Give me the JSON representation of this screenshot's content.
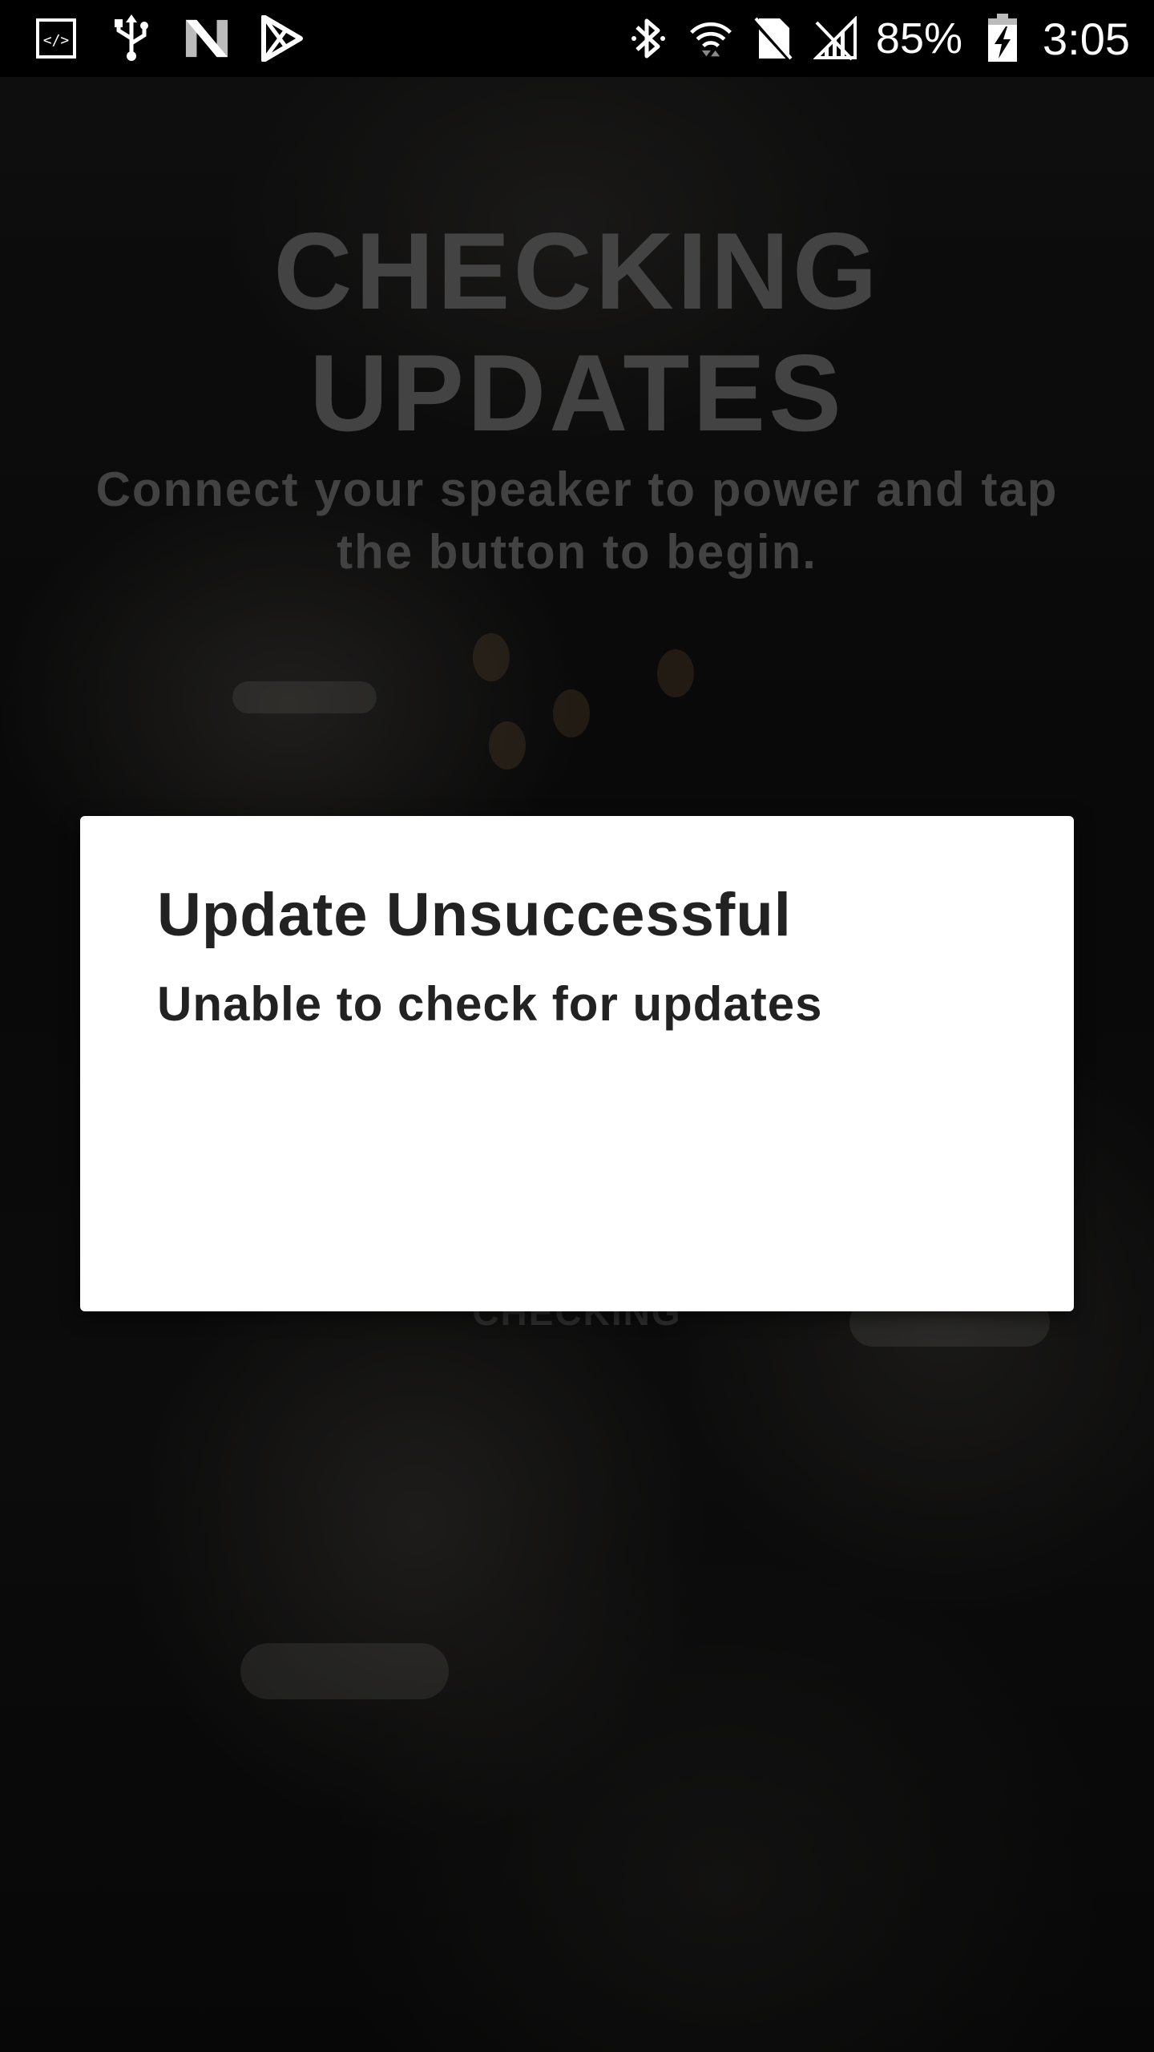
{
  "status_bar": {
    "left_icons": [
      "debug-icon",
      "usb-icon",
      "n-icon",
      "play-store-icon"
    ],
    "right_icons": [
      "bluetooth-icon",
      "wifi-icon",
      "no-sim-icon",
      "cell-signal-icon"
    ],
    "battery_percent": "85%",
    "battery_icon": "battery-charging-icon",
    "time": "3:05"
  },
  "screen": {
    "title": "CHECKING\nUPDATES",
    "subtitle": "Connect your speaker to power and tap the button to begin.",
    "button_label": "CHECKING"
  },
  "dialog": {
    "title": "Update Unsuccessful",
    "message": "Unable to check for updates"
  },
  "colors": {
    "dialog_background": "#ffffff",
    "dialog_text": "#222222",
    "dim_text": "#5a5a5a",
    "status_bar": "#000000"
  }
}
